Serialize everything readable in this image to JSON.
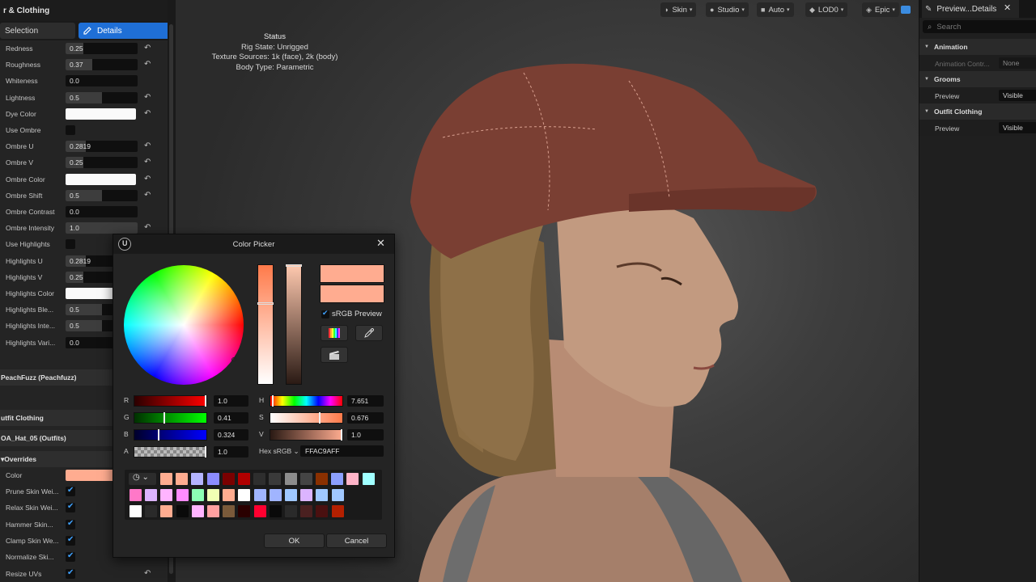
{
  "left_panel": {
    "title": "r & Clothing",
    "tabs": {
      "selection": "Selection",
      "details": "Details"
    },
    "properties": [
      {
        "label": "Redness",
        "type": "number",
        "value": "0.25",
        "fill": 0.25,
        "reset": true
      },
      {
        "label": "Roughness",
        "type": "number",
        "value": "0.37",
        "fill": 0.37,
        "reset": true
      },
      {
        "label": "Whiteness",
        "type": "number",
        "value": "0.0",
        "fill": 0,
        "reset": false
      },
      {
        "label": "Lightness",
        "type": "number",
        "value": "0.5",
        "fill": 0.5,
        "reset": true
      },
      {
        "label": "Dye Color",
        "type": "color",
        "color": "#fafafa",
        "reset": true
      },
      {
        "label": "Use Ombre",
        "type": "check",
        "checked": false,
        "reset": false
      },
      {
        "label": "Ombre U",
        "type": "number",
        "value": "0.2819",
        "fill": 0.28,
        "reset": true
      },
      {
        "label": "Ombre V",
        "type": "number",
        "value": "0.25",
        "fill": 0.25,
        "reset": true
      },
      {
        "label": "Ombre Color",
        "type": "color",
        "color": "#fafafa",
        "reset": true
      },
      {
        "label": "Ombre Shift",
        "type": "number",
        "value": "0.5",
        "fill": 0.5,
        "reset": true
      },
      {
        "label": "Ombre Contrast",
        "type": "number",
        "value": "0.0",
        "fill": 0,
        "reset": false
      },
      {
        "label": "Ombre Intensity",
        "type": "number",
        "value": "1.0",
        "fill": 1,
        "reset": true
      },
      {
        "label": "Use Highlights",
        "type": "check",
        "checked": false,
        "reset": false
      },
      {
        "label": "Highlights U",
        "type": "number",
        "value": "0.2819",
        "fill": 0.28,
        "reset": true
      },
      {
        "label": "Highlights V",
        "type": "number",
        "value": "0.25",
        "fill": 0.25,
        "reset": true
      },
      {
        "label": "Highlights Color",
        "type": "color",
        "color": "#fafafa",
        "reset": true
      },
      {
        "label": "Highlights Ble...",
        "type": "number",
        "value": "0.5",
        "fill": 0.5,
        "reset": true
      },
      {
        "label": "Highlights Inte...",
        "type": "number",
        "value": "0.5",
        "fill": 0.5,
        "reset": true
      },
      {
        "label": "Highlights Vari...",
        "type": "number",
        "value": "0.0",
        "fill": 0,
        "reset": false
      }
    ],
    "sections": {
      "peachfuzz": "PeachFuzz (Peachfuzz)",
      "outfit_clothing": "utfit Clothing",
      "hat": "OA_Hat_05 (Outfits)",
      "overrides": "Overrides"
    },
    "override_color_label": "Color",
    "override_color": "#ffac90",
    "overrides": [
      {
        "label": "Prune Skin Wei...",
        "checked": true
      },
      {
        "label": "Relax Skin Wei...",
        "checked": true
      },
      {
        "label": "Hammer Skin...",
        "checked": true
      },
      {
        "label": "Clamp Skin We...",
        "checked": true
      },
      {
        "label": "Normalize Ski...",
        "checked": true
      },
      {
        "label": "Resize UVs",
        "checked": true
      }
    ]
  },
  "viewport": {
    "toolbar": [
      {
        "label": "Skin",
        "icon": "skin-icon"
      },
      {
        "label": "Studio",
        "icon": "light-bulb-icon"
      },
      {
        "label": "Auto",
        "icon": "camera-icon"
      },
      {
        "label": "LOD0",
        "icon": "cube-icon"
      },
      {
        "label": "Epic",
        "icon": "gem-icon"
      }
    ],
    "status": {
      "heading": "Status",
      "lines": [
        "Rig State: Unrigged",
        "Texture Sources: 1k (face), 2k (body)",
        "Body Type: Parametric"
      ]
    }
  },
  "right_panel": {
    "tab_title": "Preview...Details",
    "search_placeholder": "Search",
    "sections": [
      {
        "title": "Animation",
        "rows": [
          {
            "label": "Animation Contr...",
            "value": "None",
            "disabled": true
          }
        ]
      },
      {
        "title": "Grooms",
        "rows": [
          {
            "label": "Preview",
            "value": "Visible",
            "disabled": false
          }
        ]
      },
      {
        "title": "Outfit Clothing",
        "rows": [
          {
            "label": "Preview",
            "value": "Visible",
            "disabled": false
          }
        ]
      }
    ]
  },
  "color_picker": {
    "title": "Color Picker",
    "srgb_preview_label": "sRGB Preview",
    "srgb_preview_checked": true,
    "new_color": "#ffac90",
    "old_color": "#ffac90",
    "channels": [
      {
        "label": "R",
        "value": "1.0",
        "gradient": "linear-gradient(90deg,#2a0000,#ff0000)",
        "mark": 1.0
      },
      {
        "label": "G",
        "value": "0.41",
        "gradient": "linear-gradient(90deg,#003000,#00ff00)",
        "mark": 0.41
      },
      {
        "label": "B",
        "value": "0.324",
        "gradient": "linear-gradient(90deg,#00002a,#0000ff)",
        "mark": 0.324
      },
      {
        "label": "A",
        "value": "1.0",
        "gradient": "repeating-conic-gradient(#888 0% 25%, #bbb 0% 50%) 0 0 / 8px 8px",
        "mark": 1.0
      }
    ],
    "hsv": [
      {
        "label": "H",
        "value": "7.651",
        "gradient": "linear-gradient(90deg,#ff0000,#ffff00,#00ff00,#00ffff,#0000ff,#ff00ff,#ff0000)",
        "mark": 0.02
      },
      {
        "label": "S",
        "value": "0.676",
        "gradient": "linear-gradient(90deg,#ffffff,#ff7a4a)",
        "mark": 0.676
      },
      {
        "label": "V",
        "value": "1.0",
        "gradient": "linear-gradient(90deg,#2a1a14,#ffac90)",
        "mark": 1.0
      }
    ],
    "hex_label": "Hex sRGB",
    "hex_value": "FFAC9AFF",
    "palette": [
      [
        "#ffac90",
        "#ffac90",
        "#b4b4ff",
        "#8c8cff",
        "#7a0000",
        "#b00000",
        "#2e2e2e",
        "#3a3a3a",
        "#8c8c8c",
        "#444444",
        "#8a3000",
        "#8ca0ff",
        "#ffb4c8",
        "#a0ffff"
      ],
      [
        "#ff78c8",
        "#dcb4ff",
        "#ffb4ff",
        "#ff8cff",
        "#8cffb4",
        "#f0ffb4",
        "#ffac90",
        "#ffffff",
        "#a0b4ff",
        "#a0b4ff",
        "#a0c8ff",
        "#dcb4ff",
        "#a0c8ff",
        "#a0c8ff"
      ],
      [
        "#ffffff",
        "#2a2a2a",
        "#ffac90",
        "#0a0a0a",
        "#ffb4ff",
        "#ffa0a0",
        "#7a5a3a",
        "#2a0000",
        "#ff0030",
        "#0a0a0a",
        "#2a2a2a",
        "#4a2020",
        "#4a1010",
        "#b42000"
      ]
    ],
    "ok_label": "OK",
    "cancel_label": "Cancel"
  }
}
